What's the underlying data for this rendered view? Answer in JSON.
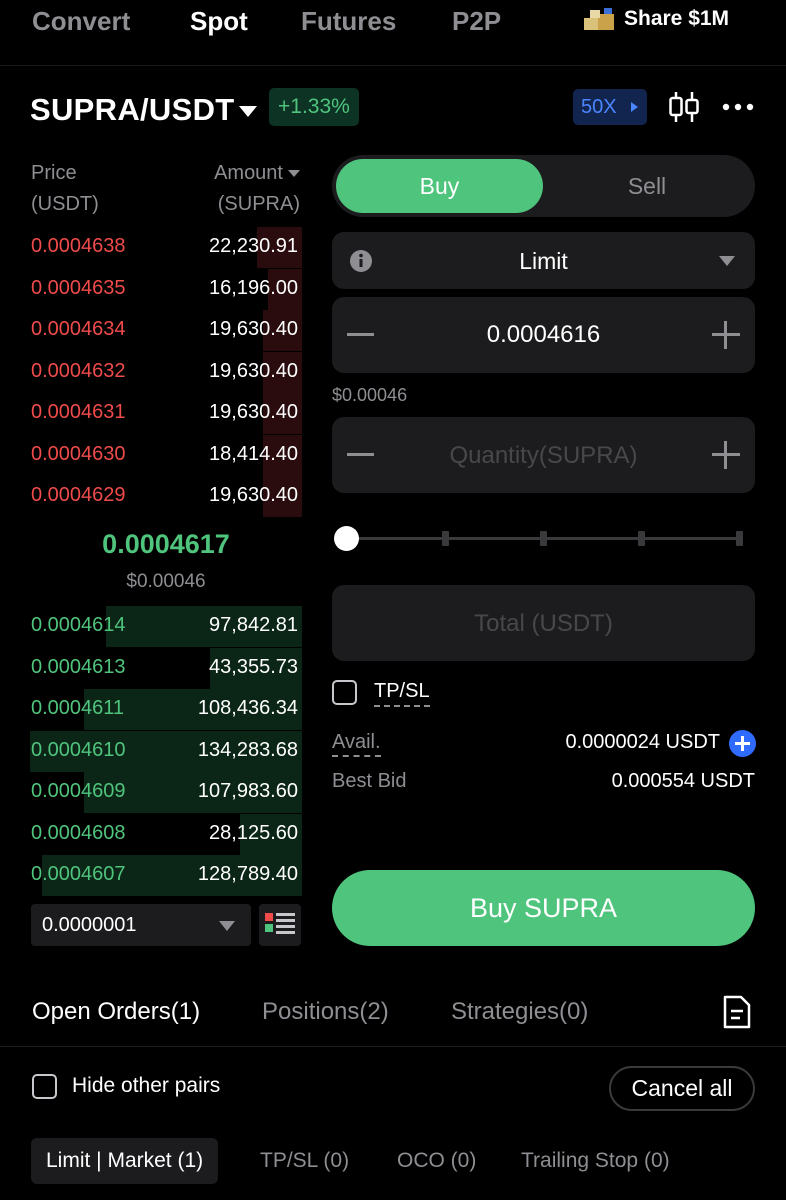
{
  "nav": {
    "tabs": [
      {
        "label": "Convert",
        "active": false
      },
      {
        "label": "Spot",
        "active": true
      },
      {
        "label": "Futures",
        "active": false
      },
      {
        "label": "P2P",
        "active": false
      }
    ],
    "share_label": "Share $1M"
  },
  "pair": {
    "symbol": "SUPRA/USDT",
    "change": "+1.33%",
    "leverage": "50X"
  },
  "orderbook": {
    "price_header": [
      "Price",
      "(USDT)"
    ],
    "amount_header": [
      "Amount",
      "(SUPRA)"
    ],
    "asks": [
      {
        "price": "0.0004638",
        "amount": "22,230.91",
        "depth": 0.16
      },
      {
        "price": "0.0004635",
        "amount": "16,196.00",
        "depth": 0.12
      },
      {
        "price": "0.0004634",
        "amount": "19,630.40",
        "depth": 0.14
      },
      {
        "price": "0.0004632",
        "amount": "19,630.40",
        "depth": 0.14
      },
      {
        "price": "0.0004631",
        "amount": "19,630.40",
        "depth": 0.14
      },
      {
        "price": "0.0004630",
        "amount": "18,414.40",
        "depth": 0.14
      },
      {
        "price": "0.0004629",
        "amount": "19,630.40",
        "depth": 0.14
      }
    ],
    "mid_price": "0.0004617",
    "mid_usd": "$0.00046",
    "bids": [
      {
        "price": "0.0004614",
        "amount": "97,842.81",
        "depth": 0.7
      },
      {
        "price": "0.0004613",
        "amount": "43,355.73",
        "depth": 0.33
      },
      {
        "price": "0.0004611",
        "amount": "108,436.34",
        "depth": 0.78
      },
      {
        "price": "0.0004610",
        "amount": "134,283.68",
        "depth": 0.97
      },
      {
        "price": "0.0004609",
        "amount": "107,983.60",
        "depth": 0.78
      },
      {
        "price": "0.0004608",
        "amount": "28,125.60",
        "depth": 0.22
      },
      {
        "price": "0.0004607",
        "amount": "128,789.40",
        "depth": 0.93
      }
    ],
    "step": "0.0000001"
  },
  "form": {
    "buy_label": "Buy",
    "sell_label": "Sell",
    "order_type": "Limit",
    "price_value": "0.0004616",
    "price_usd": "$0.00046",
    "quantity_placeholder": "Quantity(SUPRA)",
    "slider_percent": 0,
    "total_placeholder": "Total (USDT)",
    "tpsl_label": "TP/SL",
    "avail_label": "Avail.",
    "avail_value": "0.0000024 USDT",
    "best_bid_label": "Best Bid",
    "best_bid_value": "0.000554 USDT",
    "submit_label": "Buy SUPRA"
  },
  "orders": {
    "tabs": [
      "Open Orders(1)",
      "Positions(2)",
      "Strategies(0)"
    ],
    "hide_other_pairs": "Hide other pairs",
    "cancel_all": "Cancel all",
    "subtabs": [
      "Limit | Market (1)",
      "TP/SL (0)",
      "OCO (0)",
      "Trailing Stop (0)"
    ]
  },
  "colors": {
    "buy_green": "#4fc47d",
    "sell_red": "#ef4b4b",
    "accent_blue": "#2f6bff"
  }
}
